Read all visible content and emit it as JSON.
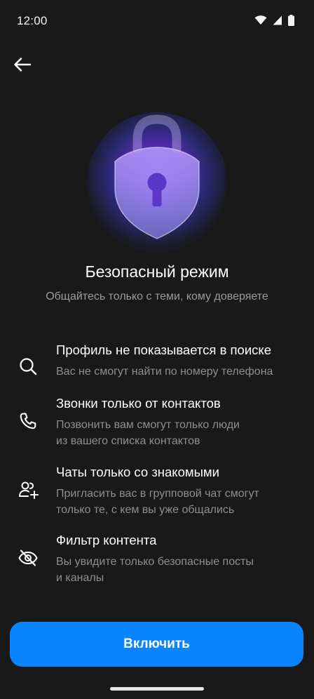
{
  "status_bar": {
    "time": "12:00"
  },
  "header": {
    "back_icon": "arrow-left-icon"
  },
  "hero": {
    "icon": "shield-lock-icon",
    "glow_color": "#8c46ff"
  },
  "title": "Безопасный режим",
  "subtitle": "Общайтесь только с теми, кому доверяете",
  "features": [
    {
      "icon": "search-icon",
      "title": "Профиль не показывается в поиске",
      "desc_lines": [
        "Вас не смогут найти по номеру телефона"
      ]
    },
    {
      "icon": "phone-icon",
      "title": "Звонки только от контактов",
      "desc_lines": [
        "Позвонить вам смогут только люди",
        "из вашего списка контактов"
      ]
    },
    {
      "icon": "add-user-group-icon",
      "title": "Чаты только со знакомыми",
      "desc_lines": [
        "Пригласить вас в групповой чат смогут",
        "только те, с кем вы уже общались"
      ]
    },
    {
      "icon": "eye-off-icon",
      "title": "Фильтр контента",
      "desc_lines": [
        "Вы увидите только безопасные посты",
        "и каналы"
      ]
    }
  ],
  "cta": {
    "label": "Включить",
    "color": "#0a84ff"
  }
}
